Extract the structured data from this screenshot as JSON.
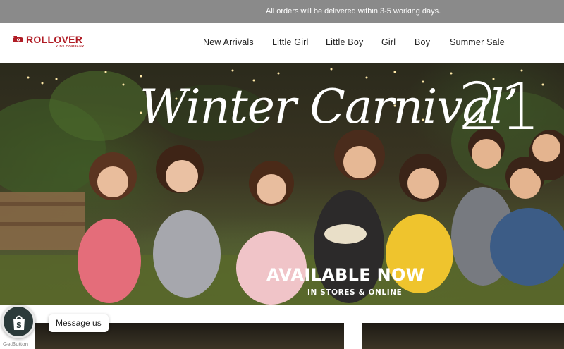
{
  "announcement": {
    "text": "All orders will be delivered within 3-5 working days."
  },
  "brand": {
    "name": "ROLLOVER",
    "tagline": "KIDS COMPANY",
    "color": "#b01c25"
  },
  "nav": {
    "items": [
      {
        "label": "New Arrivals"
      },
      {
        "label": "Little Girl"
      },
      {
        "label": "Little Boy"
      },
      {
        "label": "Girl"
      },
      {
        "label": "Boy"
      },
      {
        "label": "Summer Sale"
      }
    ]
  },
  "hero": {
    "title_script": "Winter Carnival’",
    "title_year": "21",
    "headline": "AVAILABLE NOW",
    "subline": "IN STORES & ONLINE"
  },
  "chat": {
    "message_label": "Message us",
    "button_caption": "GetButton",
    "icon": "shopify-bag-icon"
  }
}
